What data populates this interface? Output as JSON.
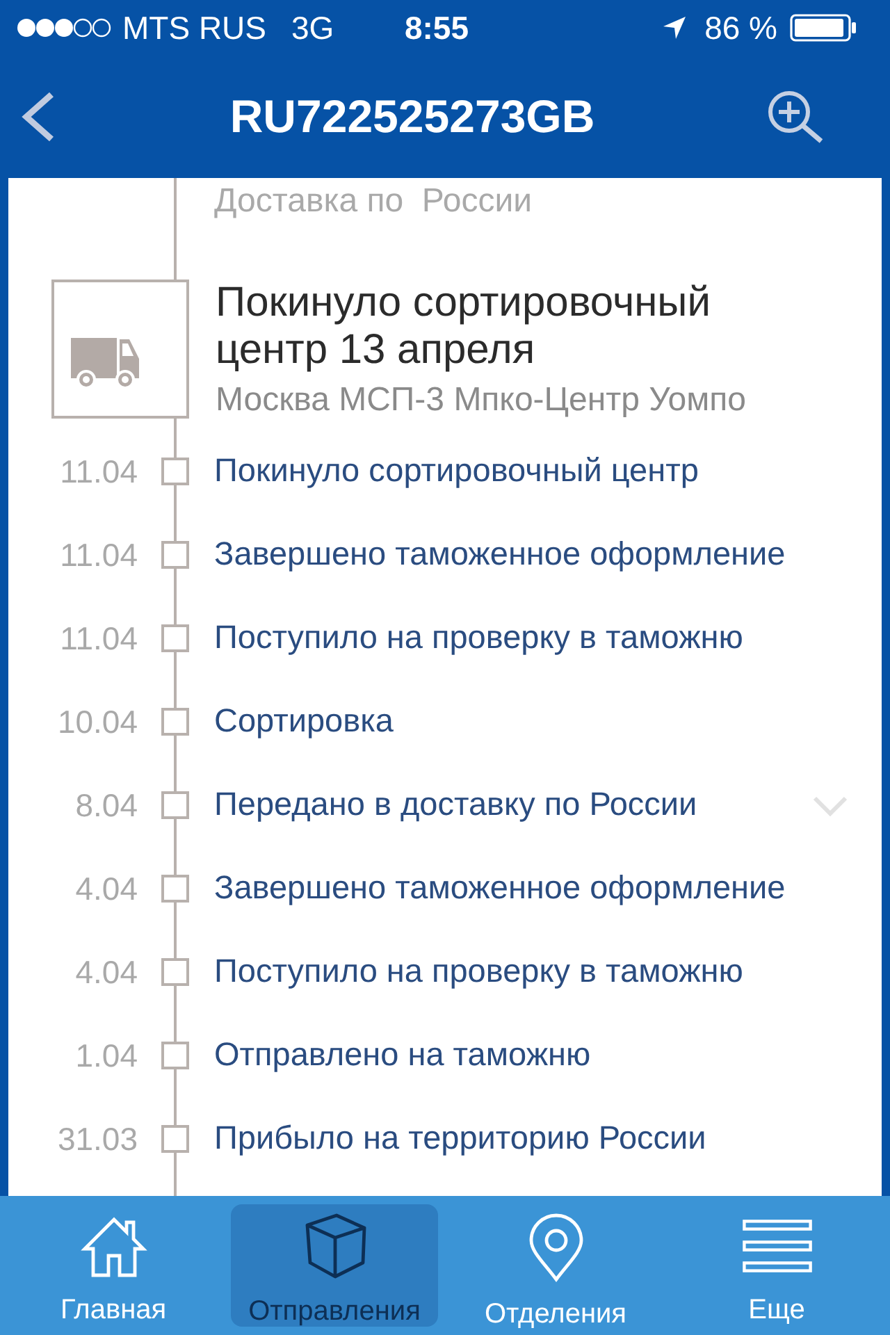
{
  "status_bar": {
    "carrier": "MTS RUS",
    "network": "3G",
    "time": "8:55",
    "battery": "86 %"
  },
  "nav_bar": {
    "title": "RU722525273GB"
  },
  "tracking": {
    "section_label": "Доставка по  России",
    "current_event": {
      "title": "Покинуло сортировочный центр 13 апреля",
      "location": "Москва МСП-3 Мпко-Центр Уомпо"
    },
    "events": [
      {
        "date": "11.04",
        "status": "Покинуло сортировочный центр",
        "expandable": false
      },
      {
        "date": "11.04",
        "status": "Завершено таможенное оформление",
        "expandable": false
      },
      {
        "date": "11.04",
        "status": "Поступило на проверку в таможню",
        "expandable": false
      },
      {
        "date": "10.04",
        "status": "Сортировка",
        "expandable": false
      },
      {
        "date": "8.04",
        "status": "Передано в доставку по России",
        "expandable": true
      },
      {
        "date": "4.04",
        "status": "Завершено таможенное оформление",
        "expandable": false
      },
      {
        "date": "4.04",
        "status": "Поступило на проверку в таможню",
        "expandable": false
      },
      {
        "date": "1.04",
        "status": "Отправлено на таможню",
        "expandable": false
      },
      {
        "date": "31.03",
        "status": "Прибыло на территорию России",
        "expandable": false
      }
    ]
  },
  "tab_bar": {
    "tabs": [
      {
        "kind": "home",
        "label": "Главная",
        "selected": false
      },
      {
        "kind": "box",
        "label": "Отправления",
        "selected": true
      },
      {
        "kind": "pin",
        "label": "Отделения",
        "selected": false
      },
      {
        "kind": "menu",
        "label": "Еще",
        "selected": false
      }
    ]
  }
}
